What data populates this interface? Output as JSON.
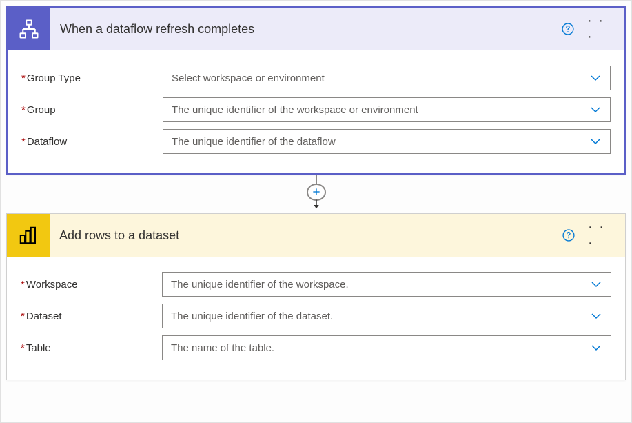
{
  "trigger": {
    "title": "When a dataflow refresh completes",
    "fields": [
      {
        "label": "Group Type",
        "placeholder": "Select workspace or environment"
      },
      {
        "label": "Group",
        "placeholder": "The unique identifier of the workspace or environment"
      },
      {
        "label": "Dataflow",
        "placeholder": "The unique identifier of the dataflow"
      }
    ]
  },
  "action": {
    "title": "Add rows to a dataset",
    "fields": [
      {
        "label": "Workspace",
        "placeholder": "The unique identifier of the workspace."
      },
      {
        "label": "Dataset",
        "placeholder": "The unique identifier of the dataset."
      },
      {
        "label": "Table",
        "placeholder": "The name of the table."
      }
    ]
  }
}
